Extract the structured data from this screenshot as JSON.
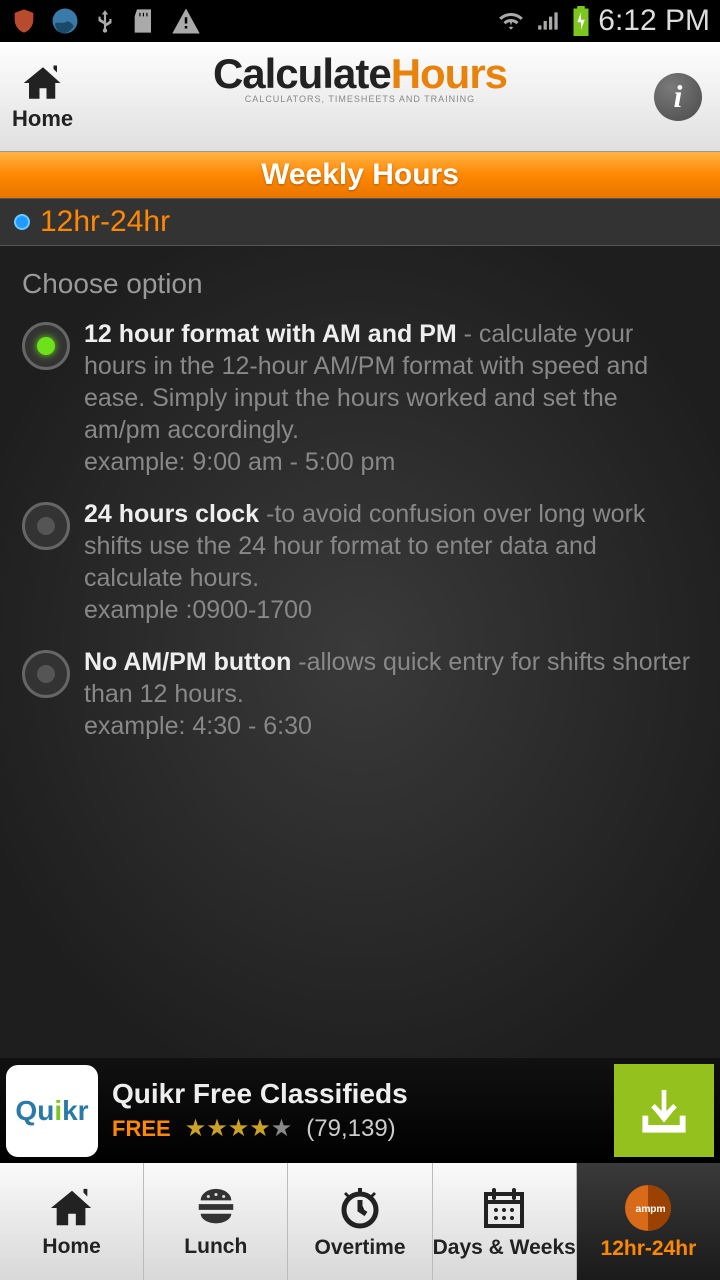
{
  "status": {
    "time": "6:12 PM"
  },
  "header": {
    "home": "Home",
    "title_a": "Calculate",
    "title_b": "Hours",
    "subtitle": "CALCULATORS, TIMESHEETS AND TRAINING",
    "sub": "Weekly Hours"
  },
  "tab": {
    "label": "12hr-24hr"
  },
  "section": {
    "title": "Choose option"
  },
  "options": [
    {
      "title": "12 hour format with AM and PM",
      "desc": " - calculate your hours in the 12-hour AM/PM format with speed and ease. Simply input the hours worked and set the am/pm accordingly.",
      "example": "example: 9:00 am - 5:00 pm",
      "selected": true
    },
    {
      "title": "24 hours clock",
      "desc": " -to avoid confusion over long work shifts use the 24 hour format to enter data and calculate hours.",
      "example": "example :0900-1700",
      "selected": false
    },
    {
      "title": "No AM/PM button",
      "desc": " -allows quick entry for shifts shorter than 12 hours.",
      "example": "example: 4:30 - 6:30",
      "selected": false
    }
  ],
  "ad": {
    "title": "Quikr Free Classifieds",
    "free": "FREE",
    "rating": 4,
    "count": "(79,139)",
    "brand_a": "Qu",
    "brand_b": "i",
    "brand_c": "kr"
  },
  "nav": {
    "items": [
      {
        "label": "Home"
      },
      {
        "label": "Lunch"
      },
      {
        "label": "Overtime"
      },
      {
        "label": "Days & Weeks"
      },
      {
        "label": "12hr-24hr"
      }
    ]
  }
}
